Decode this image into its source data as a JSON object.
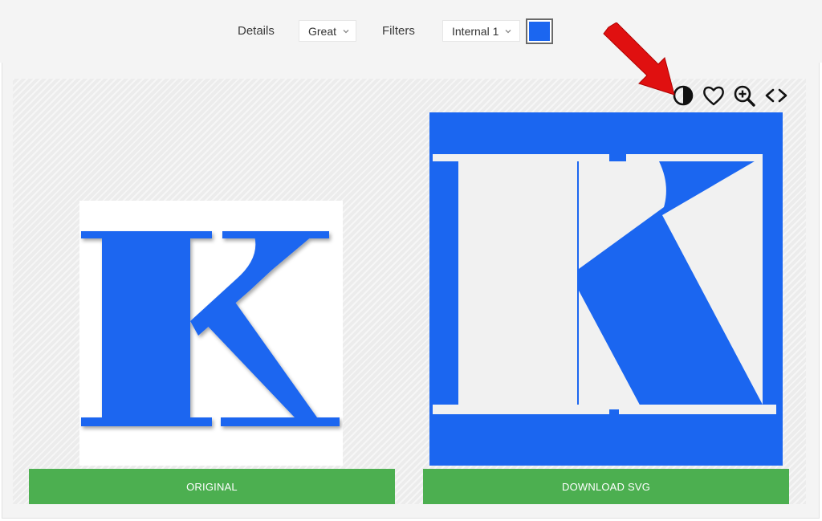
{
  "toolbar": {
    "details_label": "Details",
    "details_value": "Great",
    "filters_label": "Filters",
    "filters_value": "Internal 1",
    "color_value": "#1b66f0"
  },
  "actions": {
    "icons": [
      "contrast-icon",
      "heart-icon",
      "zoom-in-icon",
      "code-icon"
    ]
  },
  "preview": {
    "original_letter": "K",
    "vector_letter": "K"
  },
  "buttons": {
    "original": "ORIGINAL",
    "download": "DOWNLOAD SVG"
  },
  "colors": {
    "accent_blue": "#1b66f0",
    "button_green": "#4caf50",
    "arrow_red": "#e01010"
  }
}
